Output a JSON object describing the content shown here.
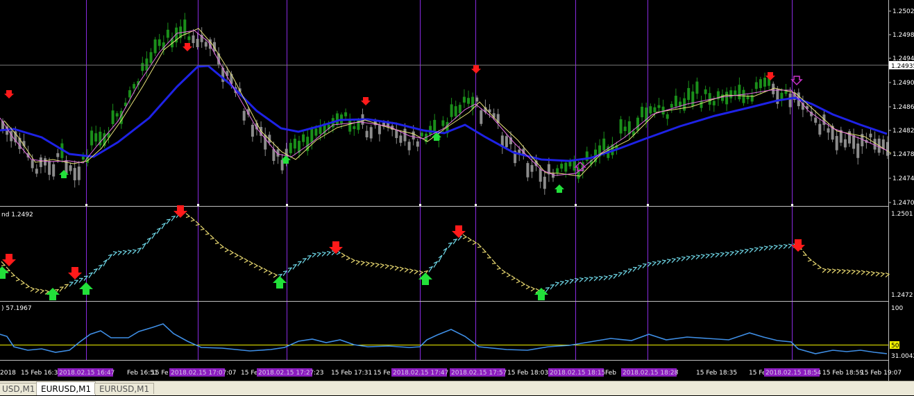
{
  "main_chart": {
    "price_axis_labels": [
      "1.25025",
      "1.24985",
      "1.24945",
      "1.24905",
      "1.24865",
      "1.24825",
      "1.24785",
      "1.24745",
      "1.24705"
    ],
    "current_price": "1.24935"
  },
  "trend_panel": {
    "label": "nd 1.2492",
    "axis_labels": [
      "1.2501",
      "1.2472"
    ]
  },
  "oscillator_panel": {
    "label": ") 57.1967",
    "axis_labels": [
      "100",
      "31.0042"
    ],
    "level_label": "50",
    "level_color": "#f2f200"
  },
  "time_axis": {
    "labels": [
      "2018",
      "15 Feb 16:35",
      "Feb 16:51",
      "15 Fe",
      ":07",
      "15 Fe",
      ":23",
      "15 Feb 17:31",
      "15 Fe",
      "15 Feb 18:03",
      "Feb",
      "7",
      "15 Feb 18:35",
      "15 Feb 18:4",
      "15 Feb 18:59",
      "15 Feb 19:07"
    ],
    "highlights": [
      "2018.02.15 16:47",
      "2018.02.15 17:07",
      "2018.02.15 17:27",
      "2018.02.15 17:47",
      "2018.02.15 17:57",
      "2018.02.15 18:15",
      "2018.02.15 18:28",
      "2018.02.15 18:54"
    ]
  },
  "tabs": [
    {
      "label": "USD,M1",
      "active": false
    },
    {
      "label": "EURUSD,M1",
      "active": true
    },
    {
      "label": "EURUSD,M1",
      "active": false
    }
  ],
  "colors": {
    "background": "#000000",
    "bull_candle": "#1a8f1a",
    "bear_candle": "#8c8c8c",
    "ma_slow": "#1e22e6",
    "ma_fast": "#e66ee6",
    "ma_mid": "#e8e27a",
    "vline": "#8a2be2",
    "arrow_buy": "#22e03a",
    "arrow_sell": "#ff1a1a",
    "trend_up": "#6fd8e8",
    "trend_down": "#e8d870",
    "oscillator": "#3f8fe6",
    "highlight": "#8b1cbf"
  }
}
